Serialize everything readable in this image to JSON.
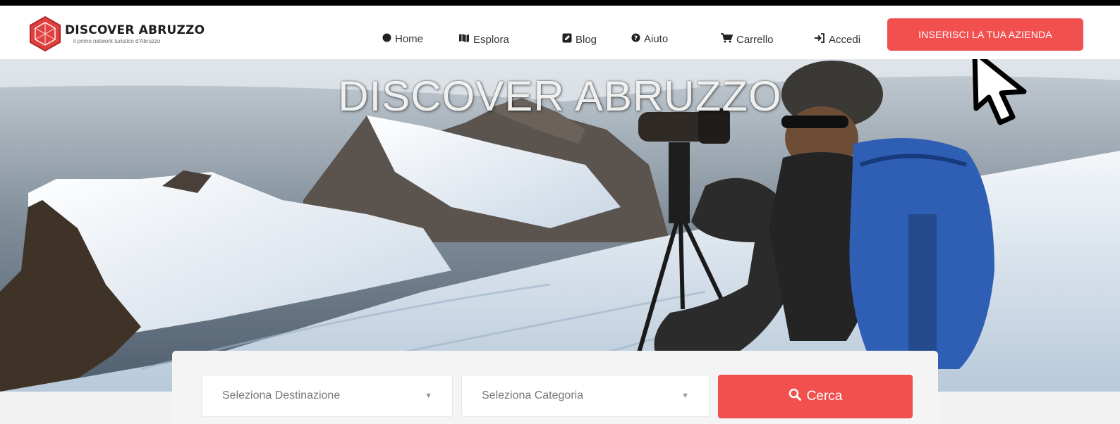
{
  "brand": {
    "title": "DISCOVER ABRUZZO",
    "subtitle": "il primo network turistico d'Abruzzo",
    "logo_color": "#e04040"
  },
  "nav": [
    {
      "icon": "circle-icon",
      "label": "Home"
    },
    {
      "icon": "map-icon",
      "label": "Esplora"
    },
    {
      "icon": "edit-icon",
      "label": "Blog"
    },
    {
      "icon": "question-circle-icon",
      "label": "Aiuto"
    },
    {
      "icon": "cart-icon",
      "label": "Carrello"
    },
    {
      "icon": "sign-in-icon",
      "label": "Accedi"
    }
  ],
  "cta": {
    "label": "INSERISCI LA TUA AZIENDA",
    "color": "#f24f4f"
  },
  "hero": {
    "title": "DISCOVER ABRUZZO"
  },
  "search": {
    "destination": {
      "placeholder": "Seleziona Destinazione"
    },
    "category": {
      "placeholder": "Seleziona Categoria"
    },
    "button": {
      "icon": "search-icon",
      "label": "Cerca"
    }
  }
}
